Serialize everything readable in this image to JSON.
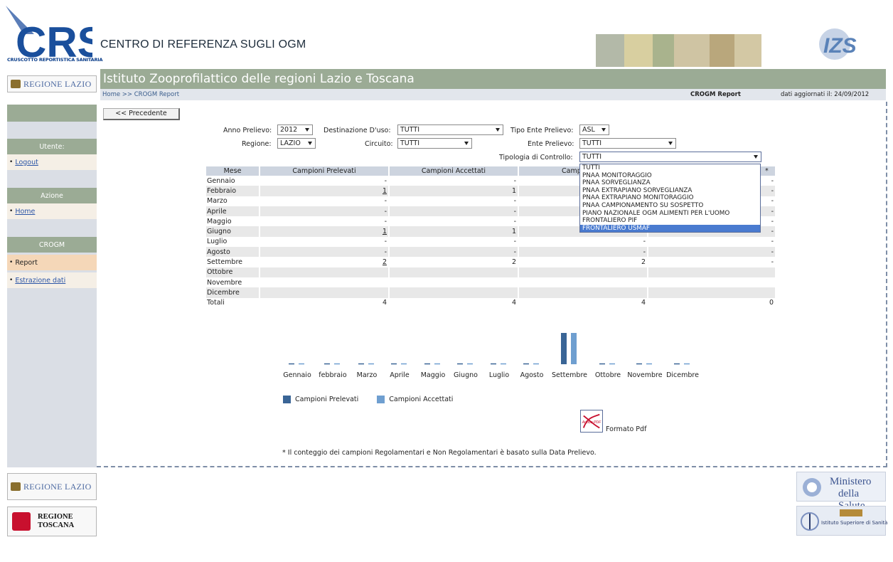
{
  "header": {
    "logo_text": "CRS",
    "logo_subtitle": "CRUSCOTTO REPORTISTICA SANITARIA",
    "site_title": "CENTRO DI REFERENZA SUGLI OGM",
    "izs_logo_text": "IZS"
  },
  "institute_bar": {
    "title": "Istituto Zooprofilattico delle regioni Lazio e Toscana",
    "breadcrumb": "Home >> CROGM Report",
    "page_title": "CROGM Report",
    "update_date": "dati aggiornati il: 24/09/2012"
  },
  "logos": {
    "regione_lazio": "REGIONE LAZIO",
    "regione_toscana_line1": "REGIONE",
    "regione_toscana_line2": "TOSCANA",
    "ministero_line1": "Ministero",
    "ministero_line2": "della Salute",
    "iss_text": "Istituto Superiore di Sanità"
  },
  "sidebar": {
    "utente_header": "Utente:",
    "logout": "Logout",
    "azione_header": "Azione",
    "home": "Home",
    "crogm_header": "CROGM",
    "report": "Report",
    "estrazione": "Estrazione dati"
  },
  "buttons": {
    "precedente": "<< Precedente"
  },
  "filters": {
    "anno_label": "Anno Prelievo:",
    "anno_value": "2012",
    "destinazione_label": "Destinazione D'uso:",
    "destinazione_value": "TUTTI",
    "tipo_ente_label": "Tipo Ente Prelievo:",
    "tipo_ente_value": "ASL",
    "regione_label": "Regione:",
    "regione_value": "LAZIO",
    "circuito_label": "Circuito:",
    "circuito_value": "TUTTI",
    "ente_label": "Ente Prelievo:",
    "ente_value": "TUTTI",
    "tipologia_label": "Tipologia di Controllo:",
    "tipologia_value": "TUTTI"
  },
  "tipologia_options": [
    "TUTTI",
    "PNAA MONITORAGGIO",
    "PNAA SORVEGLIANZA",
    "PNAA EXTRAPIANO SORVEGLIANZA",
    "PNAA EXTRAPIANO MONITORAGGIO",
    "PNAA CAMPIONAMENTO SU SOSPETTO",
    "PIANO NAZIONALE OGM ALIMENTI PER L'UOMO",
    "FRONTALIERO PIF",
    "FRONTALIERO USMAF"
  ],
  "table": {
    "headers": [
      "Mese",
      "Campioni Prelevati",
      "Campioni Accettati",
      "Campioni Re",
      "*"
    ],
    "rows": [
      [
        "Gennaio",
        "-",
        "-",
        "",
        "-"
      ],
      [
        "Febbraio",
        "1",
        "1",
        "",
        "-"
      ],
      [
        "Marzo",
        "-",
        "-",
        "",
        "-"
      ],
      [
        "Aprile",
        "-",
        "-",
        "",
        "-"
      ],
      [
        "Maggio",
        "-",
        "-",
        "",
        "-"
      ],
      [
        "Giugno",
        "1",
        "1",
        "",
        "-"
      ],
      [
        "Luglio",
        "-",
        "-",
        "-",
        "-"
      ],
      [
        "Agosto",
        "-",
        "-",
        "-",
        "-"
      ],
      [
        "Settembre",
        "2",
        "2",
        "2",
        "-"
      ],
      [
        "Ottobre",
        "",
        "",
        "",
        ""
      ],
      [
        "Novembre",
        "",
        "",
        "",
        ""
      ],
      [
        "Dicembre",
        "",
        "",
        "",
        ""
      ],
      [
        "Totali",
        "4",
        "4",
        "4",
        "0"
      ]
    ]
  },
  "chart_data": {
    "type": "bar",
    "categories": [
      "Gennaio",
      "febbraio",
      "Marzo",
      "Aprile",
      "Maggio",
      "Giugno",
      "Luglio",
      "Agosto",
      "Settembre",
      "Ottobre",
      "Novembre",
      "Dicembre"
    ],
    "series": [
      {
        "name": "Campioni Prelevati",
        "color": "#3a6596",
        "values": [
          0,
          0,
          0,
          0,
          0,
          0,
          0,
          0,
          2,
          0,
          0,
          0
        ]
      },
      {
        "name": "Campioni Accettati",
        "color": "#6f9fd0",
        "values": [
          0,
          0,
          0,
          0,
          0,
          0,
          0,
          0,
          2,
          0,
          0,
          0
        ]
      }
    ],
    "ylim": [
      0,
      2
    ]
  },
  "pdf": {
    "icon_text": "Adobe PDF",
    "label": "Formato Pdf"
  },
  "footnote": "* Il conteggio dei campioni Regolamentari e Non Regolamentari è basato sulla Data Prelievo."
}
